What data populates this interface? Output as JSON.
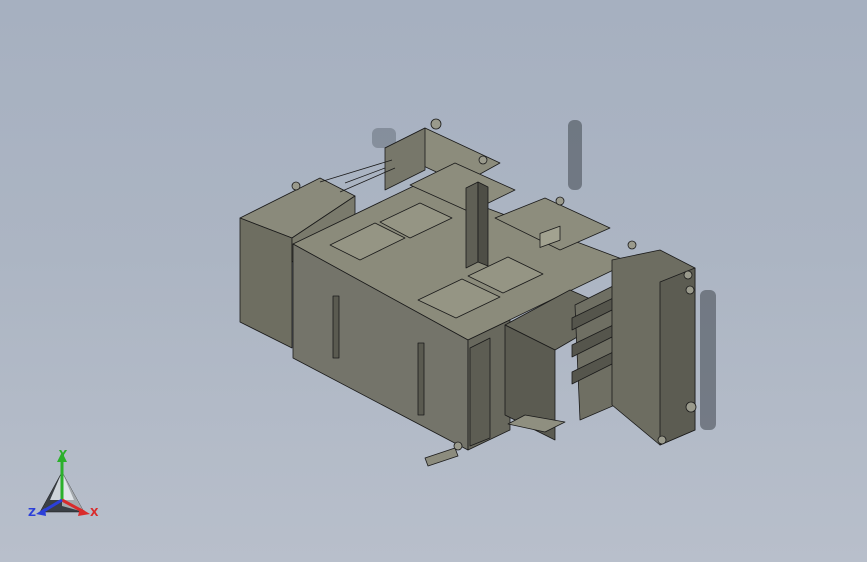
{
  "viewport": {
    "background_top": "#a6b0c0",
    "background_bottom": "#b8bfcb",
    "model_body_color": "#7d7d6e",
    "model_edge_color": "#1a1a1a",
    "model_name": ""
  },
  "triad": {
    "x_label": "X",
    "y_label": "Y",
    "z_label": "Z",
    "x_color": "#d92b2b",
    "y_color": "#2bb02b",
    "z_color": "#2b3fd9"
  }
}
